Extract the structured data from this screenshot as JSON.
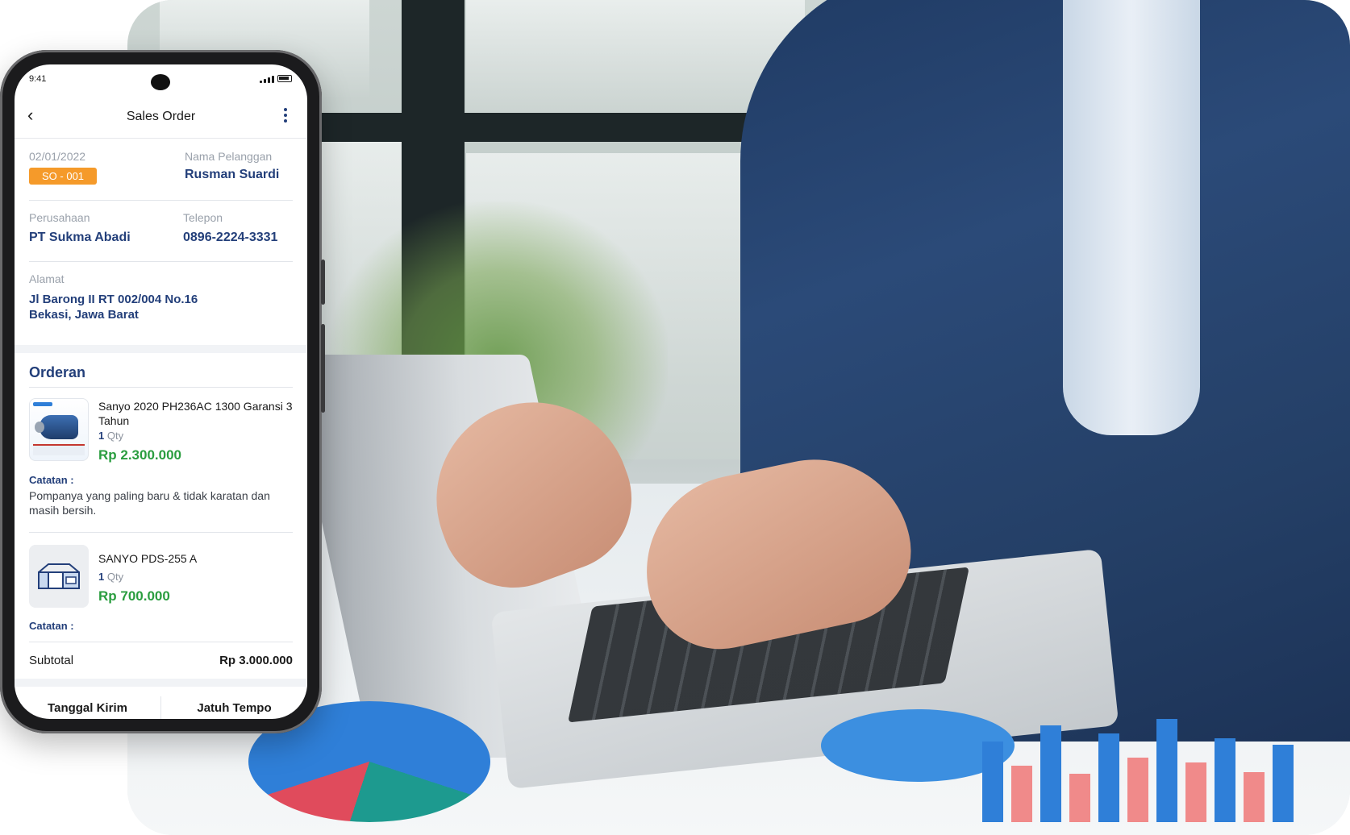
{
  "status_bar": {
    "time": "9:41"
  },
  "appbar": {
    "title": "Sales Order"
  },
  "order_header": {
    "date": "02/01/2022",
    "so_number": "SO - 001",
    "customer_label": "Nama Pelanggan",
    "customer_name": "Rusman Suardi",
    "company_label": "Perusahaan",
    "company_name": "PT Sukma Abadi",
    "phone_label": "Telepon",
    "phone_number": "0896-2224-3331",
    "address_label": "Alamat",
    "address_line1": "Jl Barong II RT 002/004 No.16",
    "address_line2": "Bekasi, Jawa Barat"
  },
  "orders": {
    "section_title": "Orderan",
    "qty_unit": "Qty",
    "note_label": "Catatan :",
    "items": [
      {
        "name": "Sanyo 2020 PH236AC 1300 Garansi 3 Tahun",
        "qty": "1",
        "price": "Rp 2.300.000",
        "note": "Pompanya yang paling baru & tidak karatan dan masih bersih.",
        "thumb_icon": "water-pump-product-image"
      },
      {
        "name": "SANYO PDS-255 A",
        "qty": "1",
        "price": "Rp 700.000",
        "note": "",
        "thumb_icon": "package-placeholder-icon"
      }
    ]
  },
  "summary": {
    "subtotal_label": "Subtotal",
    "subtotal_value": "Rp 3.000.000"
  },
  "footer": {
    "ship_date_label": "Tanggal Kirim",
    "due_label": "Jatuh Tempo"
  },
  "colors": {
    "primary": "#233f7a",
    "badge": "#f59a2a",
    "price": "#2a9d3f"
  }
}
